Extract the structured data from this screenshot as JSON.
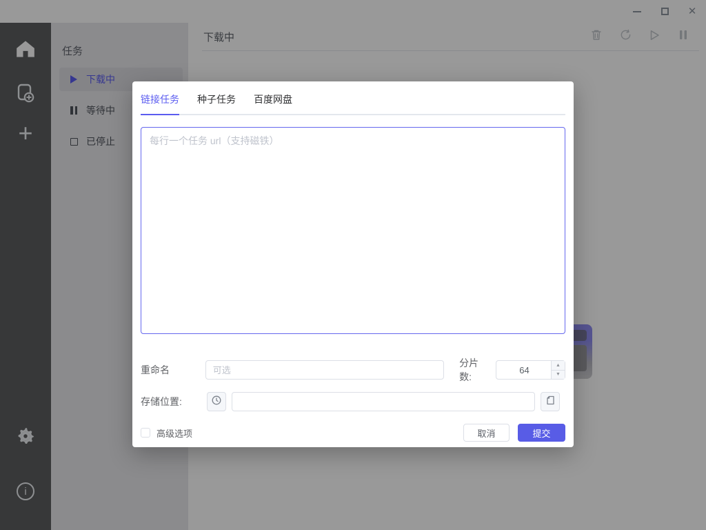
{
  "window": {
    "controls": [
      "minimize",
      "maximize",
      "close"
    ]
  },
  "rail": {
    "items": [
      "home",
      "new-task-file",
      "new-task-plus",
      "settings",
      "about"
    ]
  },
  "subnav": {
    "title": "任务",
    "items": [
      {
        "label": "下载中",
        "icon": "play-triangle",
        "active": true
      },
      {
        "label": "等待中",
        "icon": "pause-bars",
        "active": false
      },
      {
        "label": "已停止",
        "icon": "stop-square",
        "active": false
      }
    ]
  },
  "main": {
    "title": "下载中",
    "toolbar": [
      "trash",
      "refresh",
      "resume",
      "pause"
    ]
  },
  "dialog": {
    "tabs": [
      {
        "label": "链接任务",
        "active": true
      },
      {
        "label": "种子任务",
        "active": false
      },
      {
        "label": "百度网盘",
        "active": false
      }
    ],
    "url_textarea": {
      "value": "",
      "placeholder": "每行一个任务 url（支持磁铁）"
    },
    "rename": {
      "label": "重命名",
      "value": "",
      "placeholder": "可选"
    },
    "split": {
      "label": "分片数:",
      "value": "64"
    },
    "location": {
      "label": "存储位置:",
      "value": "",
      "buttons": [
        "history-clock",
        "folder"
      ]
    },
    "advanced": {
      "label": "高级选项",
      "checked": false
    },
    "cancel_label": "取消",
    "submit_label": "提交"
  },
  "icons": {
    "minimize": "—",
    "maximize": "□",
    "close": "✕",
    "plus": "+",
    "info": "i",
    "spinner_up": "▲",
    "spinner_down": "▼"
  },
  "colors": {
    "accent": "#5b5cf0",
    "submit_button": "#585ce6",
    "focus_border": "#6466ee",
    "input_border": "#dcdfe6",
    "divider": "#e4e7ed",
    "placeholder": "#bfc3cc",
    "rail_bg": "#5d5e60",
    "subnav_bg": "#e8e8eb",
    "overlay": "rgba(0,0,0,0.40)"
  }
}
